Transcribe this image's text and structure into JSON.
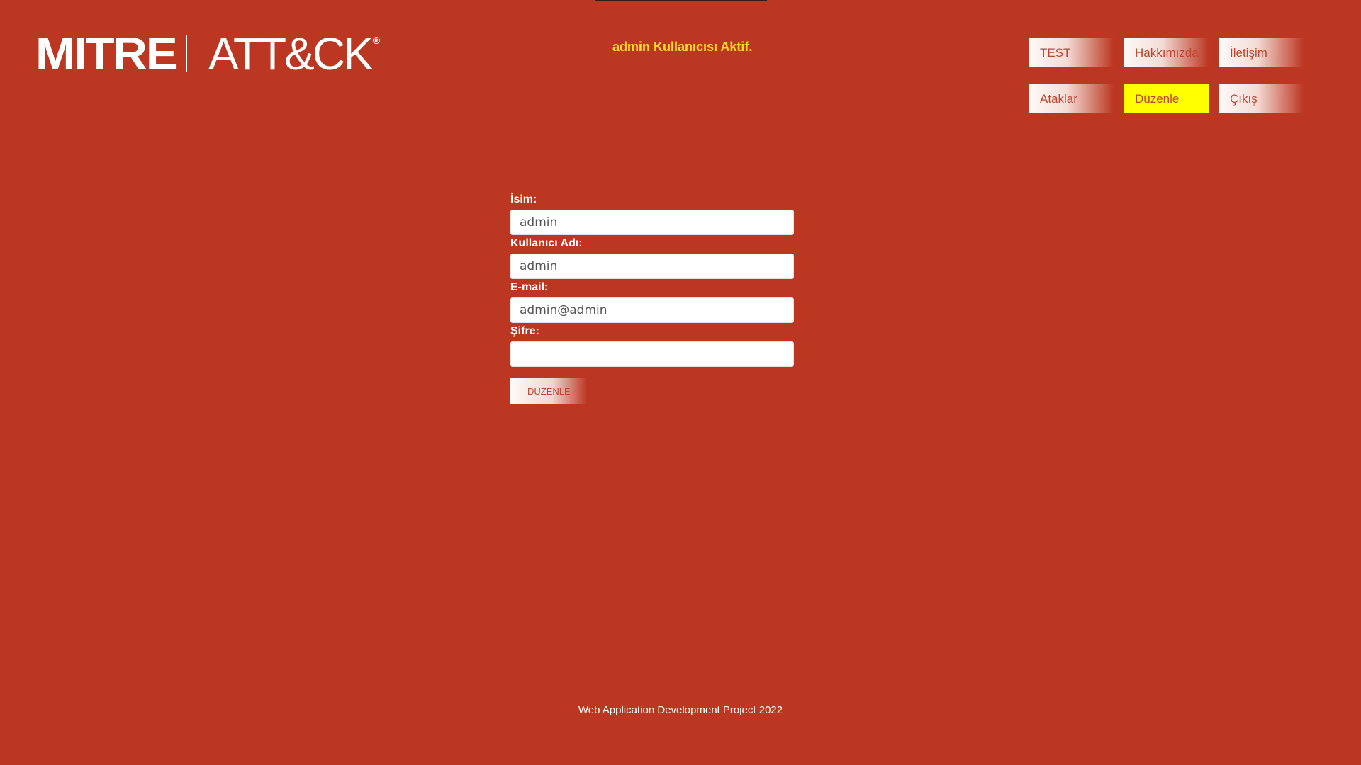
{
  "header": {
    "logo": {
      "brand_left": "MITRE",
      "brand_right": "ATT&CK",
      "registered_mark": "®"
    },
    "status_text": "admin Kullanıcısı Aktif."
  },
  "nav": {
    "items": [
      {
        "label": "TEST",
        "active": false
      },
      {
        "label": "Hakkımızda",
        "active": false
      },
      {
        "label": "İletişim",
        "active": false
      },
      {
        "label": "Ataklar",
        "active": false
      },
      {
        "label": "Düzenle",
        "active": true
      },
      {
        "label": "Çıkış",
        "active": false
      }
    ]
  },
  "form": {
    "fields": [
      {
        "label": "İsim:",
        "value": "admin"
      },
      {
        "label": "Kullanıcı Adı:",
        "value": "admin"
      },
      {
        "label": "E-mail:",
        "value": "admin@admin"
      },
      {
        "label": "Şifre:",
        "value": ""
      }
    ],
    "submit_label": "Düzenle"
  },
  "footer": {
    "text": "Web Application Development Project 2022"
  },
  "colors": {
    "background": "#bc3722",
    "status_text": "#ffe21a",
    "active_nav": "#ffff00",
    "button_text": "#c0452e"
  }
}
